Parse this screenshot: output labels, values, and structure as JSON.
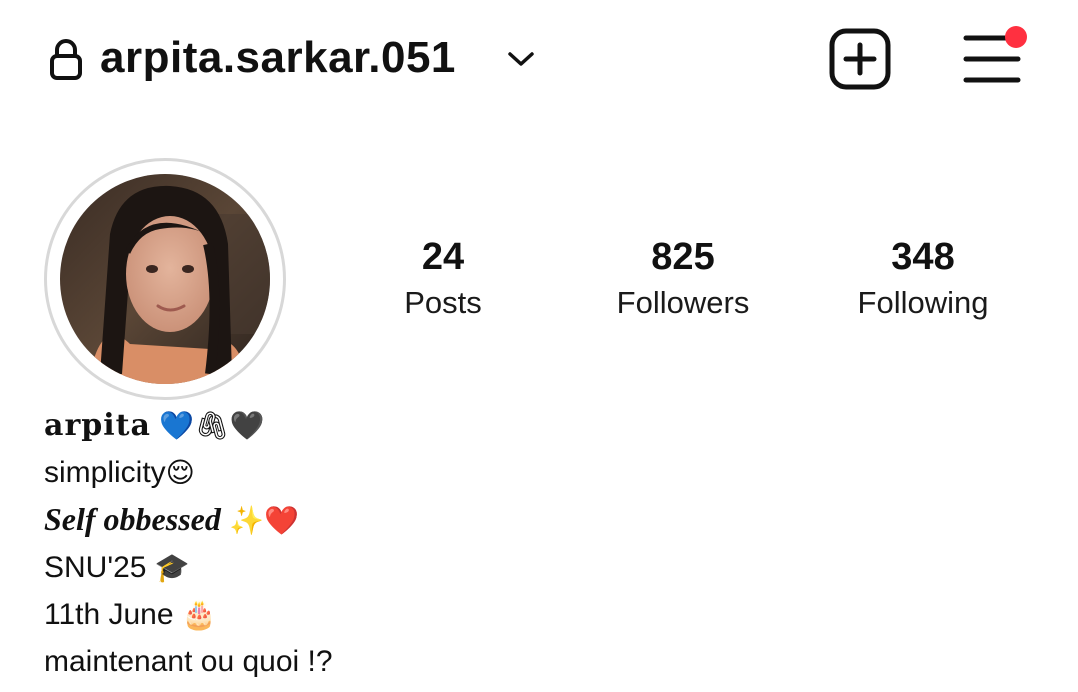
{
  "header": {
    "username": "arpita.sarkar.051"
  },
  "profile": {
    "stats": [
      {
        "value": "24",
        "label": "Posts"
      },
      {
        "value": "825",
        "label": "Followers"
      },
      {
        "value": "348",
        "label": "Following"
      }
    ],
    "bio": {
      "name": "arpita",
      "name_emoji": "💙🖇🖤",
      "line1": "simplicity",
      "line1_emoji": "😌",
      "line2": "Self obbessed",
      "line2_emoji": "✨❤️",
      "line3": "SNU'25",
      "line3_emoji": "🎓",
      "line4": "11th June",
      "line4_emoji": "🎂",
      "line5": "maintenant ou quoi !?"
    }
  },
  "icons": {
    "lock": "lock-icon",
    "chevron": "chevron-down-icon",
    "add": "add-post-icon",
    "menu": "hamburger-menu-icon",
    "notification_dot_color": "#ff3040"
  }
}
